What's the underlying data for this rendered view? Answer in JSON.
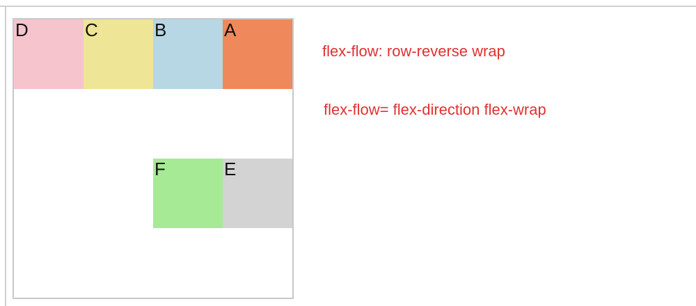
{
  "colors": {
    "note_text": "#e03131",
    "container_border": "#c8c8c8",
    "item_d": "#f5c4cc",
    "item_c": "#efe597",
    "item_b": "#b6d7e3",
    "item_a": "#ef885a",
    "item_f": "#a6ea96",
    "item_e": "#d3d3d3"
  },
  "flex_demo": {
    "items": [
      {
        "id": "D",
        "label": "D"
      },
      {
        "id": "C",
        "label": "C"
      },
      {
        "id": "B",
        "label": "B"
      },
      {
        "id": "A",
        "label": "A"
      },
      {
        "id": "F",
        "label": "F"
      },
      {
        "id": "E",
        "label": "E"
      }
    ]
  },
  "notes": {
    "line1": "flex-flow: row-reverse wrap",
    "line2": "flex-flow= flex-direction flex-wrap"
  }
}
